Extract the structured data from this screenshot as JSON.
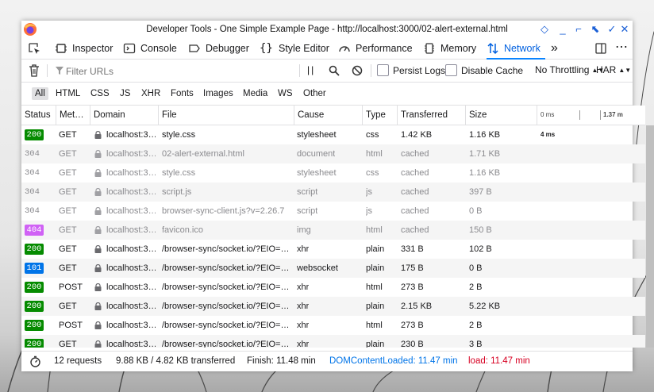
{
  "window": {
    "title": "Developer Tools - One Simple Example Page - http://localhost:3000/02-alert-external.html"
  },
  "tools": [
    {
      "id": "inspector",
      "label": "Inspector"
    },
    {
      "id": "console",
      "label": "Console"
    },
    {
      "id": "debugger",
      "label": "Debugger"
    },
    {
      "id": "style-editor",
      "label": "Style Editor"
    },
    {
      "id": "performance",
      "label": "Performance"
    },
    {
      "id": "memory",
      "label": "Memory"
    },
    {
      "id": "network",
      "label": "Network",
      "active": true
    }
  ],
  "filter": {
    "placeholder": "Filter URLs",
    "persist_logs": "Persist Logs",
    "disable_cache": "Disable Cache",
    "throttling": "No Throttling",
    "har": "HAR"
  },
  "type_filters": [
    "All",
    "HTML",
    "CSS",
    "JS",
    "XHR",
    "Fonts",
    "Images",
    "Media",
    "WS",
    "Other"
  ],
  "columns": {
    "status": "Status",
    "method": "Met…",
    "domain": "Domain",
    "file": "File",
    "cause": "Cause",
    "type": "Type",
    "transferred": "Transferred",
    "size": "Size",
    "tick0": "0 ms",
    "tick1": "1.37 m"
  },
  "requests": [
    {
      "status": "200",
      "method": "GET",
      "domain": "localhost:3…",
      "file": "style.css",
      "cause": "stylesheet",
      "type": "css",
      "transferred": "1.42 KB",
      "size": "1.16 KB",
      "waterfall": "4 ms",
      "cached": false
    },
    {
      "status": "304",
      "method": "GET",
      "domain": "localhost:3…",
      "file": "02-alert-external.html",
      "cause": "document",
      "type": "html",
      "transferred": "cached",
      "size": "1.71 KB",
      "cached": true
    },
    {
      "status": "304",
      "method": "GET",
      "domain": "localhost:3…",
      "file": "style.css",
      "cause": "stylesheet",
      "type": "css",
      "transferred": "cached",
      "size": "1.16 KB",
      "cached": true
    },
    {
      "status": "304",
      "method": "GET",
      "domain": "localhost:3…",
      "file": "script.js",
      "cause": "script",
      "type": "js",
      "transferred": "cached",
      "size": "397 B",
      "cached": true
    },
    {
      "status": "304",
      "method": "GET",
      "domain": "localhost:3…",
      "file": "browser-sync-client.js?v=2.26.7",
      "cause": "script",
      "type": "js",
      "transferred": "cached",
      "size": "0 B",
      "cached": true
    },
    {
      "status": "404",
      "method": "GET",
      "domain": "localhost:3…",
      "file": "favicon.ico",
      "cause": "img",
      "type": "html",
      "transferred": "cached",
      "size": "150 B",
      "cached": true
    },
    {
      "status": "200",
      "method": "GET",
      "domain": "localhost:3…",
      "file": "/browser-sync/socket.io/?EIO=…",
      "cause": "xhr",
      "type": "plain",
      "transferred": "331 B",
      "size": "102 B",
      "cached": false
    },
    {
      "status": "101",
      "method": "GET",
      "domain": "localhost:3…",
      "file": "/browser-sync/socket.io/?EIO=…",
      "cause": "websocket",
      "type": "plain",
      "transferred": "175 B",
      "size": "0 B",
      "cached": false
    },
    {
      "status": "200",
      "method": "POST",
      "domain": "localhost:3…",
      "file": "/browser-sync/socket.io/?EIO=…",
      "cause": "xhr",
      "type": "html",
      "transferred": "273 B",
      "size": "2 B",
      "cached": false
    },
    {
      "status": "200",
      "method": "GET",
      "domain": "localhost:3…",
      "file": "/browser-sync/socket.io/?EIO=…",
      "cause": "xhr",
      "type": "plain",
      "transferred": "2.15 KB",
      "size": "5.22 KB",
      "cached": false
    },
    {
      "status": "200",
      "method": "POST",
      "domain": "localhost:3…",
      "file": "/browser-sync/socket.io/?EIO=…",
      "cause": "xhr",
      "type": "html",
      "transferred": "273 B",
      "size": "2 B",
      "cached": false
    },
    {
      "status": "200",
      "method": "GET",
      "domain": "localhost:3…",
      "file": "/browser-sync/socket.io/?EIO=…",
      "cause": "xhr",
      "type": "plain",
      "transferred": "230 B",
      "size": "3 B",
      "cached": false
    }
  ],
  "summary": {
    "requests": "12 requests",
    "transferred": "9.88 KB / 4.82 KB transferred",
    "finish": "Finish: 11.48 min",
    "dom": "DOMContentLoaded: 11.47 min",
    "load": "load: 11.47 min"
  },
  "colors": {
    "status_200": "#058b00",
    "status_101": "#0074e8",
    "status_404": "#d062f5",
    "accent": "#0a84ff",
    "dom": "#0074e8",
    "load": "#d70022"
  }
}
